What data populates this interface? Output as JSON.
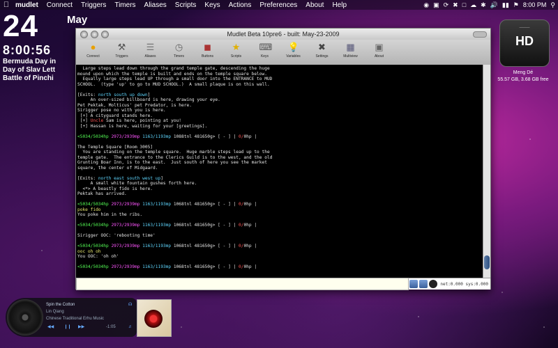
{
  "menubar": {
    "app_name": "mudlet",
    "items": [
      "Connect",
      "Triggers",
      "Timers",
      "Aliases",
      "Scripts",
      "Keys",
      "Actions",
      "Preferences",
      "About",
      "Help"
    ],
    "clock": "8:00 PM"
  },
  "desktop_clock": {
    "day": "24",
    "month": "May",
    "time": "8:00:56",
    "lines": [
      "Bermuda Day in",
      "Day of Slav Lett",
      "Battle of Pinchi"
    ]
  },
  "drive": {
    "icon_text": "HD",
    "name": "Meng Dé",
    "info": "55.57 GB, 3.68 GB free"
  },
  "window": {
    "title": "Mudlet Beta 10pre6 - built: May-23-2009",
    "toolbar": [
      "Connect",
      "Triggers",
      "Aliases",
      "Timers",
      "Buttons",
      "Scripts",
      "Keys",
      "Variables",
      "Settings",
      "Multiview",
      "About"
    ],
    "input_value": "",
    "status_text": "net:0.000 sys:0.000"
  },
  "console_lines": [
    [
      {
        "t": "  Large steps lead down through the grand temple gate, descending the huge",
        "c": "#e6e6e6"
      }
    ],
    [
      {
        "t": "mound upon which the temple is built and ends on the temple square below.",
        "c": "#e6e6e6"
      }
    ],
    [
      {
        "t": "  Equally large steps lead UP through a small door into the ENTRANCE to MUD",
        "c": "#e6e6e6"
      }
    ],
    [
      {
        "t": "SCHOOL.  (type 'up' to go to MUD SCHOOL.)  A small plaque is on this wall.",
        "c": "#e6e6e6"
      }
    ],
    [
      {
        "t": "",
        "c": "#e6e6e6"
      }
    ],
    [
      {
        "t": "[Exits: ",
        "c": "#e6e6e6"
      },
      {
        "t": "north south up down",
        "c": "#5fd7ff"
      },
      {
        "t": "]",
        "c": "#e6e6e6"
      }
    ],
    [
      {
        "t": "     An over-sized billboard is here, drawing your eye.",
        "c": "#e6e6e6"
      }
    ],
    [
      {
        "t": "Pet ",
        "c": "#e6e6e6"
      },
      {
        "t": "Pektak, Molticus' pet Predator, is here.",
        "c": "#e6e6e6"
      }
    ],
    [
      {
        "t": "Sirigger pose no with you is here.",
        "c": "#e6e6e6"
      }
    ],
    [
      {
        "t": " [+] A cityguard stands here.",
        "c": "#e6e6e6"
      }
    ],
    [
      {
        "t": " [+] ",
        "c": "#e6e6e6"
      },
      {
        "t": "Uncle",
        "c": "#ff5555"
      },
      {
        "t": " Sam is here, pointing at you!",
        "c": "#e6e6e6"
      }
    ],
    [
      {
        "t": " [+] Hassan is here, waiting for your [greetings].",
        "c": "#e6e6e6"
      }
    ],
    [
      {
        "t": "",
        "c": "#e6e6e6"
      }
    ],
    [
      {
        "t": "<5034/5034hp ",
        "c": "#55ff55"
      },
      {
        "t": "2973/2939mp ",
        "c": "#ff55ff"
      },
      {
        "t": "1163/1193mp ",
        "c": "#5fd7ff"
      },
      {
        "t": "1088tnl 481650g> [ - ] | ",
        "c": "#e6e6e6"
      },
      {
        "t": "0/",
        "c": "#ff5555"
      },
      {
        "t": "0hp |",
        "c": "#e6e6e6"
      }
    ],
    [
      {
        "t": "",
        "c": "#e6e6e6"
      }
    ],
    [
      {
        "t": "The Temple Square [Room 3005]",
        "c": "#e6e6e6"
      }
    ],
    [
      {
        "t": "  You are standing on the temple square.  Huge marble steps lead up to the",
        "c": "#e6e6e6"
      }
    ],
    [
      {
        "t": "temple gate.  The entrance to the Clerics Guild is to the west, and the old",
        "c": "#e6e6e6"
      }
    ],
    [
      {
        "t": "Grunting Boar Inn, is to the east.  Just south of here you see the market",
        "c": "#e6e6e6"
      }
    ],
    [
      {
        "t": "square, the center of Midgaard.",
        "c": "#e6e6e6"
      }
    ],
    [
      {
        "t": "",
        "c": "#e6e6e6"
      }
    ],
    [
      {
        "t": "[Exits: ",
        "c": "#e6e6e6"
      },
      {
        "t": "north east south west up",
        "c": "#5fd7ff"
      },
      {
        "t": "]",
        "c": "#e6e6e6"
      }
    ],
    [
      {
        "t": "     A small white fountain gushes forth here.",
        "c": "#e6e6e6"
      }
    ],
    [
      {
        "t": "  <*> A beastly fido is here.",
        "c": "#e6e6e6"
      }
    ],
    [
      {
        "t": "Pektak has arrived.",
        "c": "#e6e6e6"
      }
    ],
    [
      {
        "t": "",
        "c": "#e6e6e6"
      }
    ],
    [
      {
        "t": "<5034/5034hp ",
        "c": "#55ff55"
      },
      {
        "t": "2973/2939mp ",
        "c": "#ff55ff"
      },
      {
        "t": "1163/1193mp ",
        "c": "#5fd7ff"
      },
      {
        "t": "1068tnl 481650g> [ - ] | ",
        "c": "#e6e6e6"
      },
      {
        "t": "0/",
        "c": "#ff5555"
      },
      {
        "t": "0hp |",
        "c": "#e6e6e6"
      }
    ],
    [
      {
        "t": "poke fido",
        "c": "#e6e66e"
      }
    ],
    [
      {
        "t": "You poke him in the ribs.",
        "c": "#e6e6e6"
      }
    ],
    [
      {
        "t": "",
        "c": "#e6e6e6"
      }
    ],
    [
      {
        "t": "<5034/5034hp ",
        "c": "#55ff55"
      },
      {
        "t": "2973/2939mp ",
        "c": "#ff55ff"
      },
      {
        "t": "1163/1193mp ",
        "c": "#5fd7ff"
      },
      {
        "t": "1068tnl 481650g> [ - ] | ",
        "c": "#e6e6e6"
      },
      {
        "t": "0/",
        "c": "#ff5555"
      },
      {
        "t": "0hp |",
        "c": "#e6e6e6"
      }
    ],
    [
      {
        "t": "",
        "c": "#e6e6e6"
      }
    ],
    [
      {
        "t": "Sirigger OOC: 'rebooting time'",
        "c": "#e6e6e6"
      }
    ],
    [
      {
        "t": "",
        "c": "#e6e6e6"
      }
    ],
    [
      {
        "t": "<5034/5034hp ",
        "c": "#55ff55"
      },
      {
        "t": "2973/2939mp ",
        "c": "#ff55ff"
      },
      {
        "t": "1163/1193mp ",
        "c": "#5fd7ff"
      },
      {
        "t": "1068tnl 481650g> [ - ] | ",
        "c": "#e6e6e6"
      },
      {
        "t": "0/",
        "c": "#ff5555"
      },
      {
        "t": "0hp |",
        "c": "#e6e6e6"
      }
    ],
    [
      {
        "t": "ooc oh oh",
        "c": "#e6e66e"
      }
    ],
    [
      {
        "t": "You OOC: 'oh oh'",
        "c": "#e6e6e6"
      }
    ],
    [
      {
        "t": "",
        "c": "#e6e6e6"
      }
    ],
    [
      {
        "t": "<5034/5034hp ",
        "c": "#55ff55"
      },
      {
        "t": "2973/2939mp ",
        "c": "#ff55ff"
      },
      {
        "t": "1163/1193mp ",
        "c": "#5fd7ff"
      },
      {
        "t": "1068tnl 481650g> [ - ] | ",
        "c": "#e6e6e6"
      },
      {
        "t": "0/",
        "c": "#ff5555"
      },
      {
        "t": "0hp |",
        "c": "#e6e6e6"
      }
    ]
  ],
  "music": {
    "track": "Spin the Cotton",
    "artist": "Lin Qiang",
    "album": "Chinese Traditional Erhu Music",
    "time": "-1:05"
  }
}
